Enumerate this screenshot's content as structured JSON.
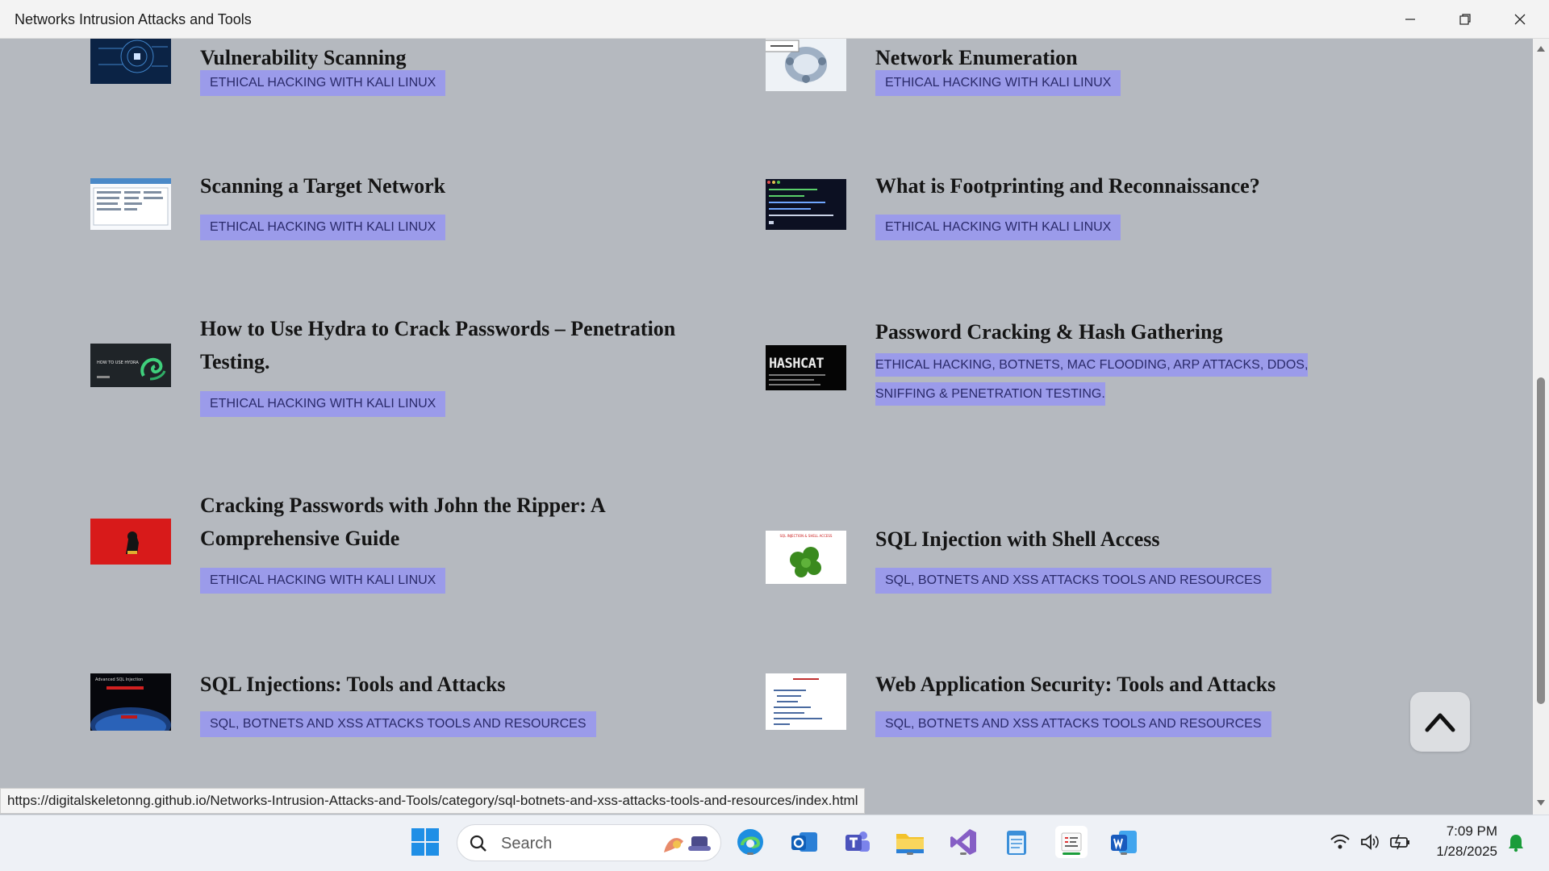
{
  "window": {
    "title": "Networks Intrusion Attacks and Tools"
  },
  "posts": [
    {
      "title": "Vulnerability Scanning",
      "tag": "ETHICAL HACKING WITH KALI LINUX"
    },
    {
      "title": "Network Enumeration",
      "tag": "ETHICAL HACKING WITH KALI LINUX"
    },
    {
      "title": "Scanning a Target Network",
      "tag": "ETHICAL HACKING WITH KALI LINUX"
    },
    {
      "title": "What is Footprinting and Reconnaissance?",
      "tag": "ETHICAL HACKING WITH KALI LINUX"
    },
    {
      "title": "How to Use Hydra to Crack Passwords – Penetration Testing.",
      "tag": "ETHICAL HACKING WITH KALI LINUX",
      "thumb_text": "HOW TO USE HYDRA"
    },
    {
      "title": "Password Cracking & Hash Gathering",
      "tag": "ETHICAL HACKING, BOTNETS, MAC FLOODING, ARP ATTACKS, DDOS, SNIFFING & PENETRATION TESTING.",
      "thumb_text": "HASHCAT"
    },
    {
      "title": "Cracking Passwords with John the Ripper: A Comprehensive Guide",
      "tag": "ETHICAL HACKING WITH KALI LINUX"
    },
    {
      "title": "SQL Injection with Shell Access",
      "tag": "SQL, BOTNETS AND XSS ATTACKS TOOLS AND RESOURCES",
      "thumb_text": "SQL INJECTION & SHELL ACCESS"
    },
    {
      "title": "SQL Injections: Tools and Attacks",
      "tag": "SQL, BOTNETS AND XSS ATTACKS TOOLS AND RESOURCES",
      "thumb_text": "Advanced SQL Injection"
    },
    {
      "title": "Web Application Security: Tools and Attacks",
      "tag": "SQL, BOTNETS AND XSS ATTACKS TOOLS AND RESOURCES"
    }
  ],
  "status_url": "https://digitalskeletonng.github.io/Networks-Intrusion-Attacks-and-Tools/category/sql-botnets-and-xss-attacks-tools-and-resources/index.html",
  "taskbar": {
    "search_label": "Search",
    "time": "7:09 PM",
    "date": "1/28/2025"
  },
  "colors": {
    "page_bg": "#b5b9bf",
    "tag_bg": "#9b9bea",
    "tag_text": "#2a2a6a"
  }
}
